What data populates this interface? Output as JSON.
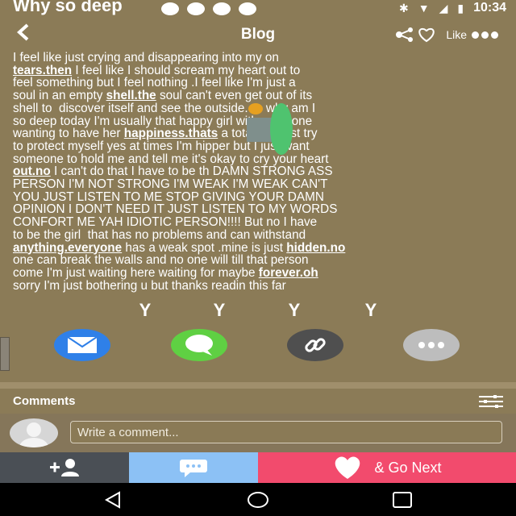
{
  "status_bar": {
    "title": "Why so deep",
    "time": "10:34"
  },
  "header": {
    "title": "Blog",
    "back_icon": "chevron-left-icon",
    "like_label": "Like"
  },
  "post": {
    "segments": [
      {
        "text": "I feel like just crying and disappearing into my on\n"
      },
      {
        "text": "tears.then",
        "link": true
      },
      {
        "text": " I feel like I should scream my heart out to\nfeel something but I feel nothing .I feel like I'm just a\nsoul in an empty "
      },
      {
        "text": "shell.the",
        "link": true
      },
      {
        "text": " soul can't even get out of its\nshell to  discover itself and see the outside."
      },
      {
        "emoji": true
      },
      {
        "text": " why am I\nso deep today I'm usually that happy girl with everyone\nwanting to have her "
      },
      {
        "text": "happiness.thats",
        "link": true
      },
      {
        "text": " a total lie I just try\nto protect myself yes at times I'm hipper but I just want\nsomeone to hold me and tell me it's okay to cry your heart\n"
      },
      {
        "text": "out.no",
        "link": true
      },
      {
        "text": " I can't do that I have to be th DAMN STRONG ASS\nPERSON I'M NOT STRONG I'M WEAK I'M WEAK CAN'T\nYOU JUST LISTEN TO ME STOP GIVING YOUR DAMN\nOPINION I DON'T NEED IT JUST LISTEN TO MY WORDS\nCONFORT ME YAH IDIOTIC PERSON!!!! But no I have\nto be the girl  that has no problems and can withstand\n"
      },
      {
        "text": "anything.everyone",
        "link": true
      },
      {
        "text": " has a weak spot .mine is just "
      },
      {
        "text": "hidden.no",
        "link": true
      },
      {
        "text": "\none can break the walls and no one will till that person\ncome I'm just waiting here waiting for maybe "
      },
      {
        "text": "forever.oh",
        "link": true
      },
      {
        "text": "\nsorry I'm just bothering u but thanks readin this far"
      }
    ]
  },
  "reactions": [
    "Y",
    "Y",
    "Y",
    "Y"
  ],
  "share": {
    "items": [
      {
        "name": "share-email-button",
        "icon": "envelope-icon",
        "color": "#2f80e8"
      },
      {
        "name": "share-message-button",
        "icon": "chat-bubble-icon",
        "color": "#5fd043"
      },
      {
        "name": "share-link-button",
        "icon": "link-icon",
        "color": "#4f4f4f"
      },
      {
        "name": "share-more-button",
        "icon": "more-dots-icon",
        "color": "#bdbdbd"
      }
    ]
  },
  "comments": {
    "title": "Comments",
    "placeholder": "Write a comment..."
  },
  "bottom_bar": {
    "next_label": "& Go Next",
    "follow_icon": "add-user-icon",
    "chat_icon": "chat-bubble-icon",
    "like_icon": "heart-icon",
    "colors": {
      "follow": "#4a4f55",
      "chat": "#8cc1f5",
      "next": "#f24b6d"
    }
  },
  "nav": {
    "back_icon": "nav-back-icon",
    "home_icon": "nav-home-icon",
    "recent_icon": "nav-recents-icon"
  }
}
